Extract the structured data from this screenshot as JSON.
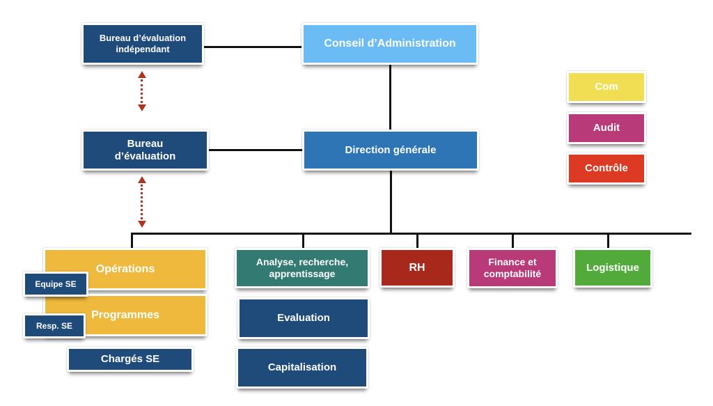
{
  "colors": {
    "dark_blue": "#1e4b7a",
    "light_blue": "#6bbcf5",
    "mid_blue": "#2e75b6",
    "yellow": "#f2de52",
    "magenta": "#b93a78",
    "red_orange": "#dc3a22",
    "gold": "#efb93d",
    "teal": "#337a72",
    "dark_red": "#a8281c",
    "green": "#52aa3a",
    "arrow_red": "#b0321f"
  },
  "top": {
    "independent_eval_office": "Bureau d’évaluation indépendant",
    "board": "Conseil d’Administration"
  },
  "middle": {
    "eval_office": "Bureau d’évaluation",
    "general_direction": "Direction générale"
  },
  "legend": {
    "items": [
      "Com",
      "Audit",
      "Contrôle"
    ]
  },
  "departments": {
    "operations": "Opérations",
    "programmes": "Programmes",
    "analysis": "Analyse, recherche, apprentissage",
    "hr": "RH",
    "finance": "Finance et comptabilité",
    "logistics": "Logistique"
  },
  "sub_units": {
    "team_se": "Equipe SE",
    "resp_se": "Resp. SE",
    "charges_se": "Chargés SE",
    "evaluation": "Evaluation",
    "capitalisation": "Capitalisation"
  }
}
